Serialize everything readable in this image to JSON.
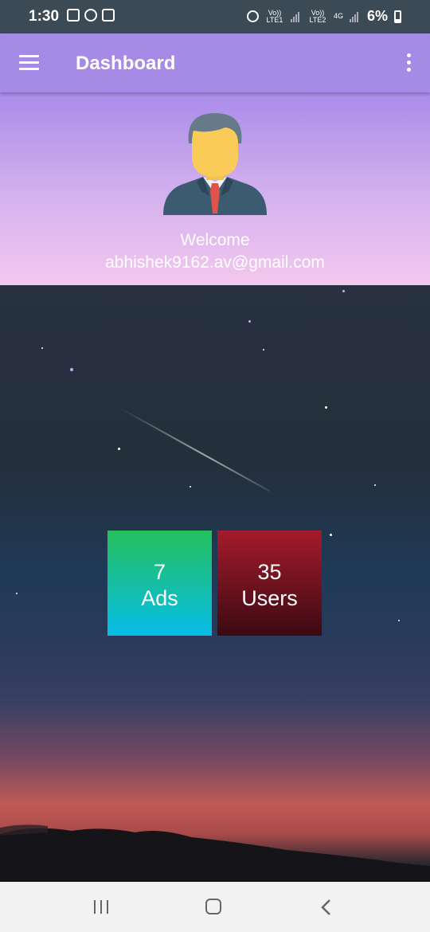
{
  "status_bar": {
    "time": "1:30",
    "sim1_label": "Vo)) LTE1",
    "sim2_label": "Vo)) LTE2",
    "network": "4G",
    "battery": "6%"
  },
  "app_bar": {
    "title": "Dashboard"
  },
  "header": {
    "welcome": "Welcome",
    "email": "abhishek9162.av@gmail.com"
  },
  "stats": {
    "ads": {
      "count": "7",
      "label": "Ads"
    },
    "users": {
      "count": "35",
      "label": "Users"
    }
  },
  "colors": {
    "app_bar": "#a58ae6",
    "ads_card_top": "#24bf5c",
    "ads_card_bottom": "#07bde8",
    "users_card_top": "#a41b2c",
    "users_card_bottom": "#3c0a12"
  },
  "icons": {
    "menu": "hamburger-icon",
    "more": "more-vert-icon",
    "avatar": "businessman-avatar-icon",
    "nav_recent": "recent-apps-icon",
    "nav_home": "home-icon",
    "nav_back": "back-icon"
  }
}
